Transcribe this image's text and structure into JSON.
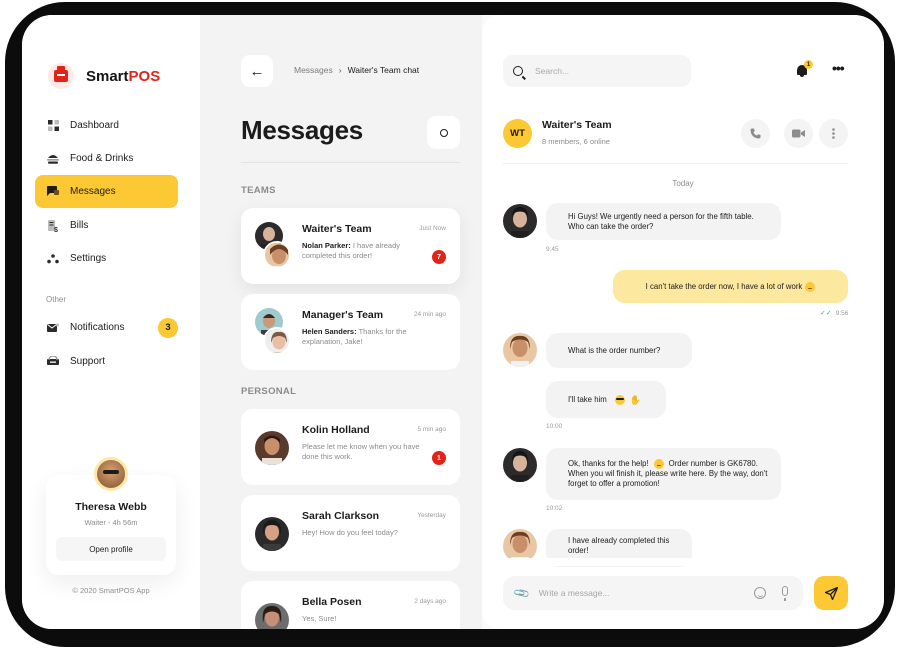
{
  "app": {
    "name_prefix": "Smart",
    "name_suffix": "POS",
    "copyright": "© 2020 SmartPOS App",
    "accent_color": "#fcc934",
    "brand_color": "#e2231a"
  },
  "sidebar": {
    "items": [
      {
        "label": "Dashboard",
        "icon": "grid-icon"
      },
      {
        "label": "Food & Drinks",
        "icon": "burger-icon"
      },
      {
        "label": "Messages",
        "icon": "chat-icon",
        "active": true
      },
      {
        "label": "Bills",
        "icon": "bill-icon"
      },
      {
        "label": "Settings",
        "icon": "dots-icon"
      }
    ],
    "other_label": "Other",
    "other_items": [
      {
        "label": "Notifications",
        "icon": "mail-icon",
        "badge": "3"
      },
      {
        "label": "Support",
        "icon": "support-icon"
      }
    ]
  },
  "profile": {
    "name": "Theresa Webb",
    "role": "Waiter - 4h 56m",
    "button": "Open profile"
  },
  "messages": {
    "breadcrumb_parent": "Messages",
    "breadcrumb_current": "Waiter's Team chat",
    "title": "Messages",
    "teams_label": "TEAMS",
    "personal_label": "PERSONAL",
    "teams": [
      {
        "name": "Waiter's Team",
        "time": "Just Now",
        "sender": "Nolan Parker:",
        "preview": "I have already completed this order!",
        "unread": "7"
      },
      {
        "name": "Manager's Team",
        "time": "24 min ago",
        "sender": "Helen Sanders:",
        "preview": "Thanks for the explanation, Jake!"
      }
    ],
    "personal": [
      {
        "name": "Kolin Holland",
        "time": "5 min ago",
        "preview": "Please let me know when you have done this work.",
        "unread": "1"
      },
      {
        "name": "Sarah Clarkson",
        "time": "Yesterday",
        "preview": "Hey! How do you feel today?"
      },
      {
        "name": "Bella Posen",
        "time": "2 days ago",
        "preview": "Yes, Sure!"
      }
    ]
  },
  "chat": {
    "search_placeholder": "Search...",
    "notification_count": "1",
    "initials": "WT",
    "name": "Waiter's Team",
    "members": "8 members, 6 online",
    "day": "Today",
    "messages": [
      {
        "from": "other",
        "text": "Hi Guys!  We urgently need a person for the fifth table. Who can take the order?",
        "time": "9:45"
      },
      {
        "from": "me",
        "text": "I can't take the order now, I have a lot of work",
        "time": "9:56"
      },
      {
        "from": "other",
        "text": "What is the order number?"
      },
      {
        "from": "other",
        "text": "I'll take him",
        "time": "10:00"
      },
      {
        "from": "other",
        "text": "Ok, thanks for the help!",
        "text2": "Order number is GK6780. When you wil finish it, please write here. By the way, don't forget to offer a promotion!",
        "time": "10:02"
      },
      {
        "from": "other",
        "text": "I have already completed this order!"
      }
    ],
    "composer_placeholder": "Write a message..."
  }
}
